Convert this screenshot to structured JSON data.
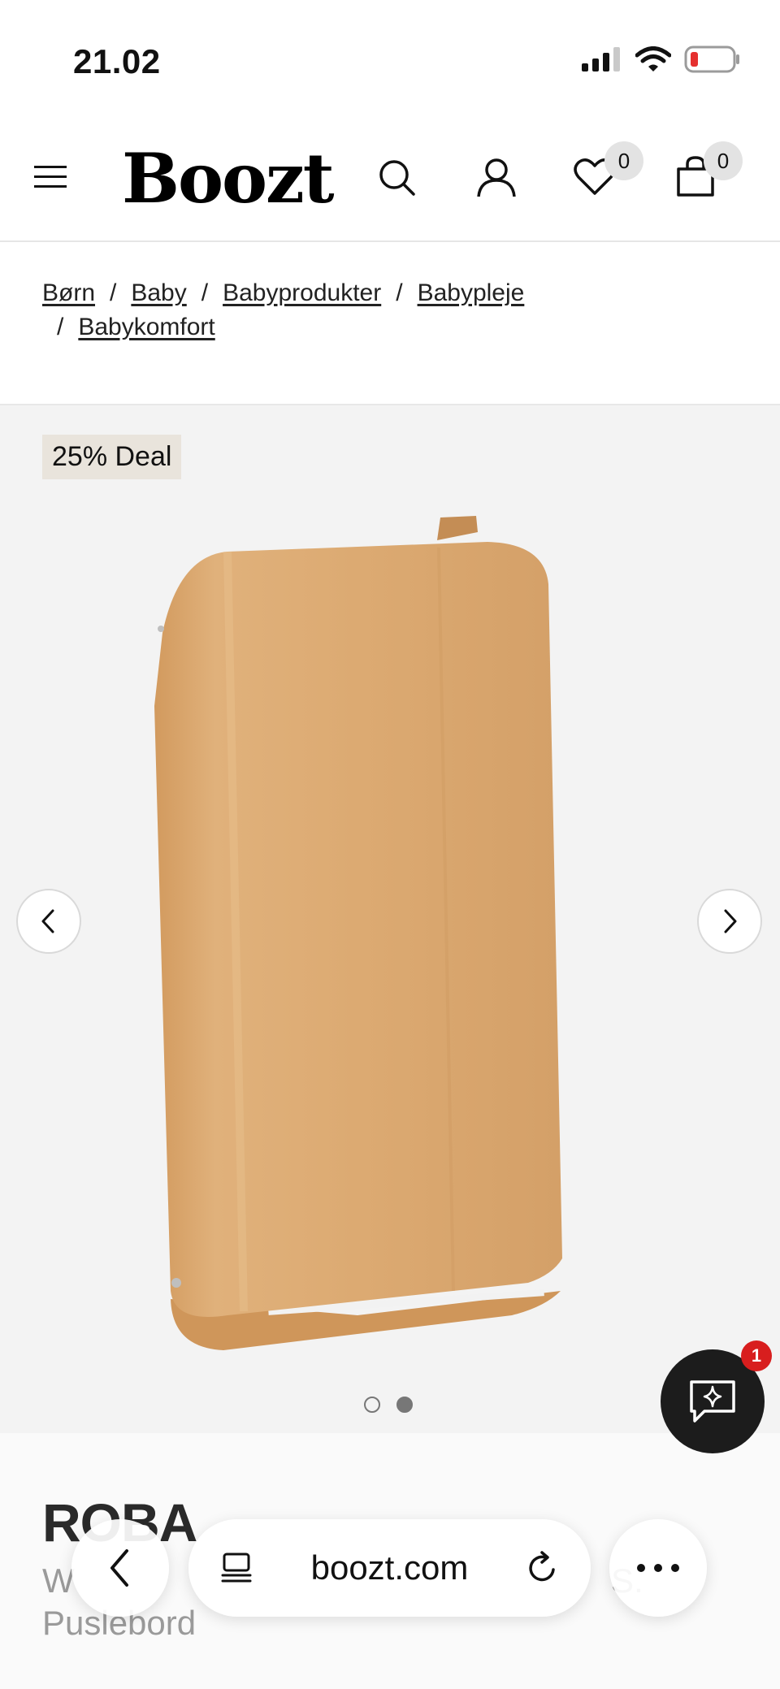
{
  "status_bar": {
    "time": "21.02",
    "icons": [
      "cellular-signal-icon",
      "wifi-icon",
      "battery-low-icon"
    ]
  },
  "header": {
    "logo": "Boozt",
    "icons": [
      "hamburger-menu-icon",
      "search-icon",
      "account-icon",
      "heart-icon",
      "shopping-bag-icon"
    ],
    "wishlist_count": "0",
    "cart_count": "0"
  },
  "breadcrumb": {
    "items": [
      "Børn",
      "Baby",
      "Babyprodukter",
      "Babypleje",
      "Babykomfort"
    ],
    "separator": "/"
  },
  "gallery": {
    "deal_label": "25% Deal",
    "current_image": 2,
    "total_images": 2
  },
  "chat": {
    "unread_count": "1"
  },
  "product": {
    "brand": "ROBA",
    "name_line1": "W",
    "name_visible_tail": "S.",
    "name_line2": "Puslebord"
  },
  "browser": {
    "url": "boozt.com"
  },
  "colors": {
    "wood": "#dcaa71",
    "chat_button": "#1c1c1c",
    "badge_red": "#d81e1e",
    "deal_bg": "#e9e4dc"
  }
}
